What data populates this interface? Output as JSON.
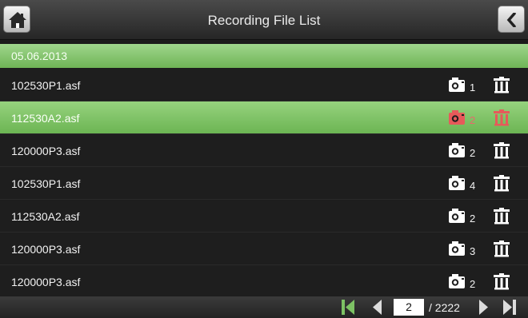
{
  "header": {
    "title": "Recording File List",
    "home_icon": "home-icon",
    "back_icon": "back-chevron-icon"
  },
  "date_group": {
    "label": "05.06.2013"
  },
  "files": [
    {
      "name": "102530P1.asf",
      "count": "1",
      "selected": false
    },
    {
      "name": "112530A2.asf",
      "count": "2",
      "selected": true
    },
    {
      "name": "120000P3.asf",
      "count": "2",
      "selected": false
    },
    {
      "name": "102530P1.asf",
      "count": "4",
      "selected": false
    },
    {
      "name": "112530A2.asf",
      "count": "2",
      "selected": false
    },
    {
      "name": "120000P3.asf",
      "count": "3",
      "selected": false
    },
    {
      "name": "120000P3.asf",
      "count": "2",
      "selected": false
    }
  ],
  "pagination": {
    "current_page": "2",
    "total_label": "/ 2222"
  },
  "colors": {
    "accent_green": "#7dc264",
    "selected_icon_red": "#e65a5a",
    "icon_white": "#ffffff"
  }
}
